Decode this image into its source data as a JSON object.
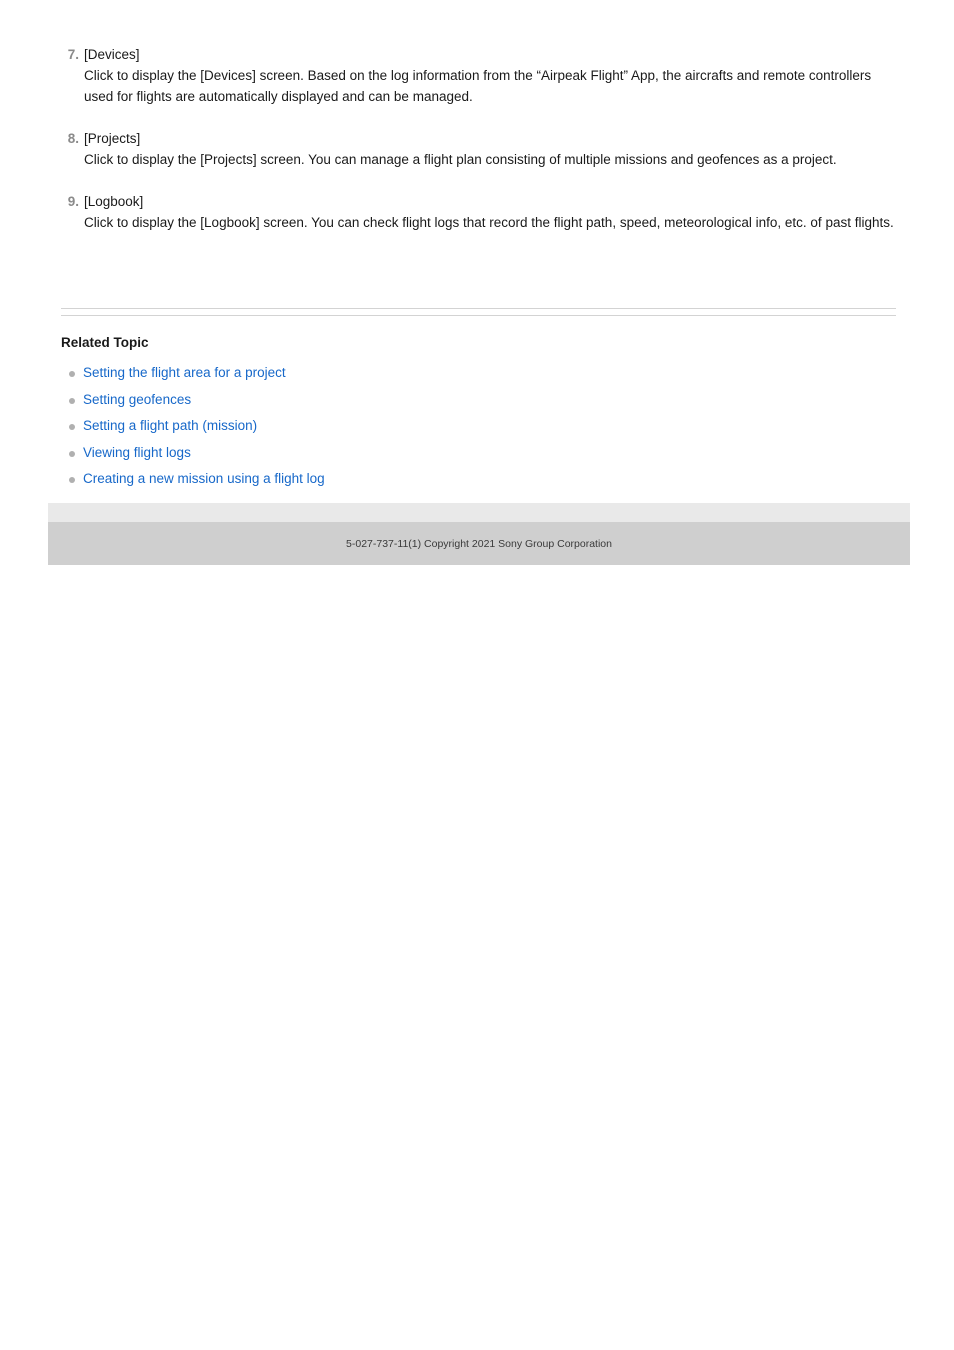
{
  "steps": [
    {
      "number": "7.",
      "title": "[Devices]",
      "body": "Click to display the [Devices] screen. Based on the log information from the “Airpeak Flight” App, the aircrafts and remote controllers used for flights are automatically displayed and can be managed."
    },
    {
      "number": "8.",
      "title": "[Projects]",
      "body": "Click to display the [Projects] screen. You can manage a flight plan consisting of multiple missions and geofences as a project."
    },
    {
      "number": "9.",
      "title": "[Logbook]",
      "body": "Click to display the [Logbook] screen. You can check flight logs that record the flight path, speed, meteorological info, etc. of past flights."
    }
  ],
  "related": {
    "heading": "Related Topic",
    "bullet_icon": "dot-bullet-icon",
    "links": [
      {
        "label": "Setting the flight area for a project"
      },
      {
        "label": "Setting geofences"
      },
      {
        "label": "Setting a flight path (mission)"
      },
      {
        "label": "Viewing flight logs"
      },
      {
        "label": "Creating a new mission using a flight log"
      }
    ]
  },
  "footer": {
    "copyright": "5-027-737-11(1) Copyright 2021 Sony Group Corporation"
  },
  "colors": {
    "link": "#1768c9",
    "text": "#1a1a1a",
    "step_number": "#8a8a8a",
    "bullet": "#b0b0b0",
    "divider": "#d3d3d3",
    "footer_top_band": "#e9e9e9",
    "footer_bottom_band": "#cfcfcf"
  }
}
